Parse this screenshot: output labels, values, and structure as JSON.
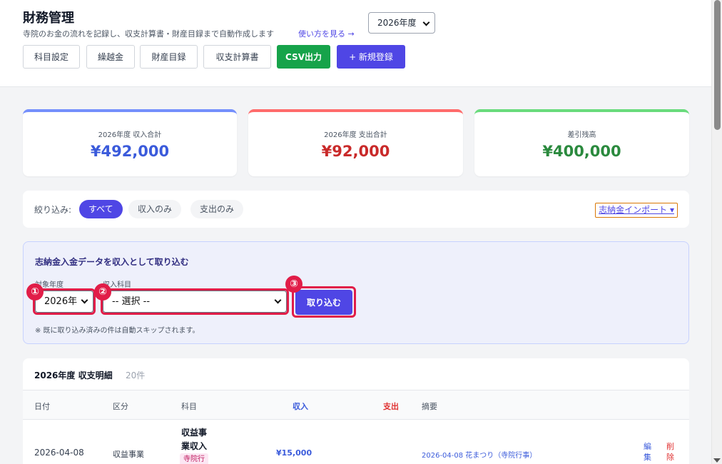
{
  "header": {
    "title": "財務管理",
    "subtitle": "寺院のお金の流れを記録し、収支計算書・財産目録まで自動作成します",
    "howto_link": "使い方を見る →",
    "year_select": "2026年度",
    "buttons": {
      "subjects": "科目設定",
      "carryover": "繰越金",
      "assets": "財産目録",
      "statement": "収支計算書",
      "csv": "CSV出力",
      "new": "+ 新規登録"
    }
  },
  "summary": [
    {
      "label": "2026年度 収入合計",
      "value": "¥492,000",
      "color": "#3b5bdb"
    },
    {
      "label": "2026年度 支出合計",
      "value": "¥92,000",
      "color": "#c92a2a"
    },
    {
      "label": "差引残高",
      "value": "¥400,000",
      "color": "#2b8a3e"
    }
  ],
  "filter": {
    "label": "絞り込み:",
    "all": "すべて",
    "income_only": "収入のみ",
    "expense_only": "支出のみ",
    "import_button": "志納金インポート ▾"
  },
  "import_panel": {
    "title": "志納金入金データを収入として取り込む",
    "year_label": "対象年度",
    "year_value": "2026年",
    "subject_label": "収入科目",
    "subject_value": "-- 選択 --",
    "submit": "取り込む",
    "note": "※ 既に取り込み済みの件は自動スキップされます。",
    "badges": [
      "①",
      "②",
      "③"
    ]
  },
  "table": {
    "title": "2026年度 収支明細",
    "count": "20件",
    "columns": {
      "date": "日付",
      "category": "区分",
      "subject": "科目",
      "income": "収入",
      "expense": "支出",
      "memo": "摘要"
    },
    "rows": [
      {
        "date": "2026-04-08",
        "category": "収益事業",
        "subject_line1": "収益事",
        "subject_line2": "業収入",
        "tag": "寺院行",
        "income": "¥15,000",
        "memo": "2026-04-08 花まつり（寺院行事）",
        "edit": "編集",
        "delete": "削除"
      }
    ]
  }
}
